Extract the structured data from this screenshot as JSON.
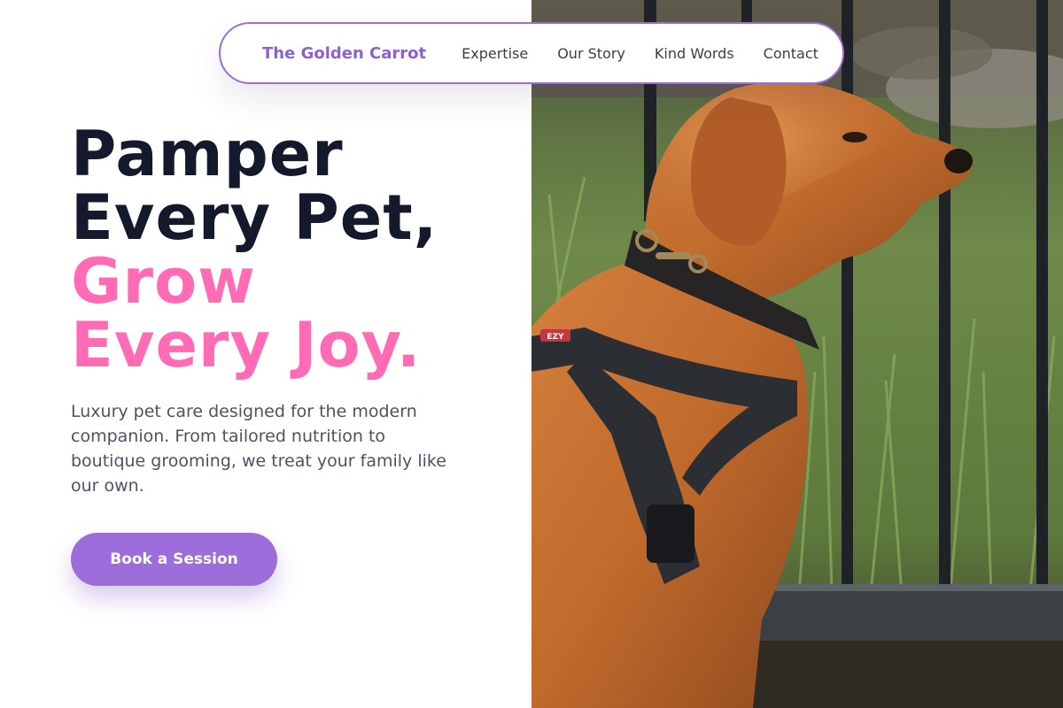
{
  "nav": {
    "brand": "The Golden Carrot",
    "links": [
      "Expertise",
      "Our Story",
      "Kind Words",
      "Contact"
    ]
  },
  "hero": {
    "headline_line1": "Pamper",
    "headline_line2": "Every Pet,",
    "headline_line3": "Grow",
    "headline_line4": "Every Joy.",
    "subtitle": "Luxury pet care designed for the modern companion. From tailored nutrition to boutique grooming, we treat your family like our own.",
    "cta_label": "Book a Session"
  },
  "photo": {
    "subject": "dog-in-harness-photo",
    "harness_tag": "EZY"
  },
  "colors": {
    "brand_purple": "#8e60cf",
    "cta_purple": "#9d6ddb",
    "accent_pink": "#ff6bb5",
    "headline_dark": "#141a2b",
    "body_gray": "#4b5363"
  }
}
